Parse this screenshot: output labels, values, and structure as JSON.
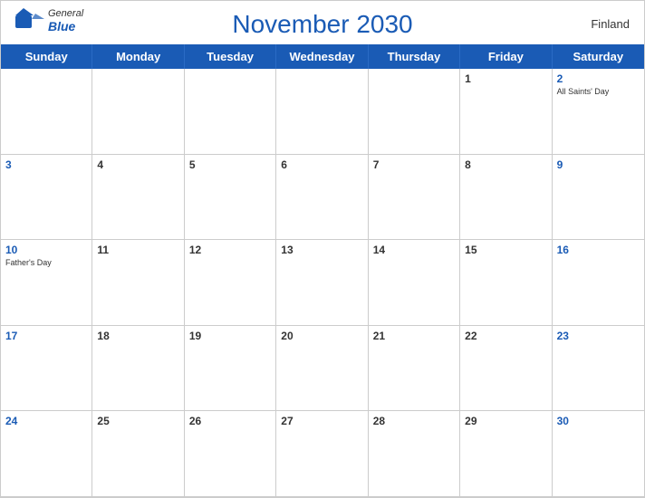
{
  "header": {
    "title": "November 2030",
    "country": "Finland",
    "logo": {
      "line1": "General",
      "line2": "Blue"
    }
  },
  "days": [
    "Sunday",
    "Monday",
    "Tuesday",
    "Wednesday",
    "Thursday",
    "Friday",
    "Saturday"
  ],
  "weeks": [
    [
      {
        "date": "",
        "empty": true
      },
      {
        "date": "",
        "empty": true
      },
      {
        "date": "",
        "empty": true
      },
      {
        "date": "",
        "empty": true
      },
      {
        "date": "",
        "empty": true
      },
      {
        "date": "1",
        "holiday": ""
      },
      {
        "date": "2",
        "holiday": "All Saints' Day"
      }
    ],
    [
      {
        "date": "3",
        "holiday": ""
      },
      {
        "date": "4",
        "holiday": ""
      },
      {
        "date": "5",
        "holiday": ""
      },
      {
        "date": "6",
        "holiday": ""
      },
      {
        "date": "7",
        "holiday": ""
      },
      {
        "date": "8",
        "holiday": ""
      },
      {
        "date": "9",
        "holiday": ""
      }
    ],
    [
      {
        "date": "10",
        "holiday": "Father's Day"
      },
      {
        "date": "11",
        "holiday": ""
      },
      {
        "date": "12",
        "holiday": ""
      },
      {
        "date": "13",
        "holiday": ""
      },
      {
        "date": "14",
        "holiday": ""
      },
      {
        "date": "15",
        "holiday": ""
      },
      {
        "date": "16",
        "holiday": ""
      }
    ],
    [
      {
        "date": "17",
        "holiday": ""
      },
      {
        "date": "18",
        "holiday": ""
      },
      {
        "date": "19",
        "holiday": ""
      },
      {
        "date": "20",
        "holiday": ""
      },
      {
        "date": "21",
        "holiday": ""
      },
      {
        "date": "22",
        "holiday": ""
      },
      {
        "date": "23",
        "holiday": ""
      }
    ],
    [
      {
        "date": "24",
        "holiday": ""
      },
      {
        "date": "25",
        "holiday": ""
      },
      {
        "date": "26",
        "holiday": ""
      },
      {
        "date": "27",
        "holiday": ""
      },
      {
        "date": "28",
        "holiday": ""
      },
      {
        "date": "29",
        "holiday": ""
      },
      {
        "date": "30",
        "holiday": ""
      }
    ]
  ]
}
